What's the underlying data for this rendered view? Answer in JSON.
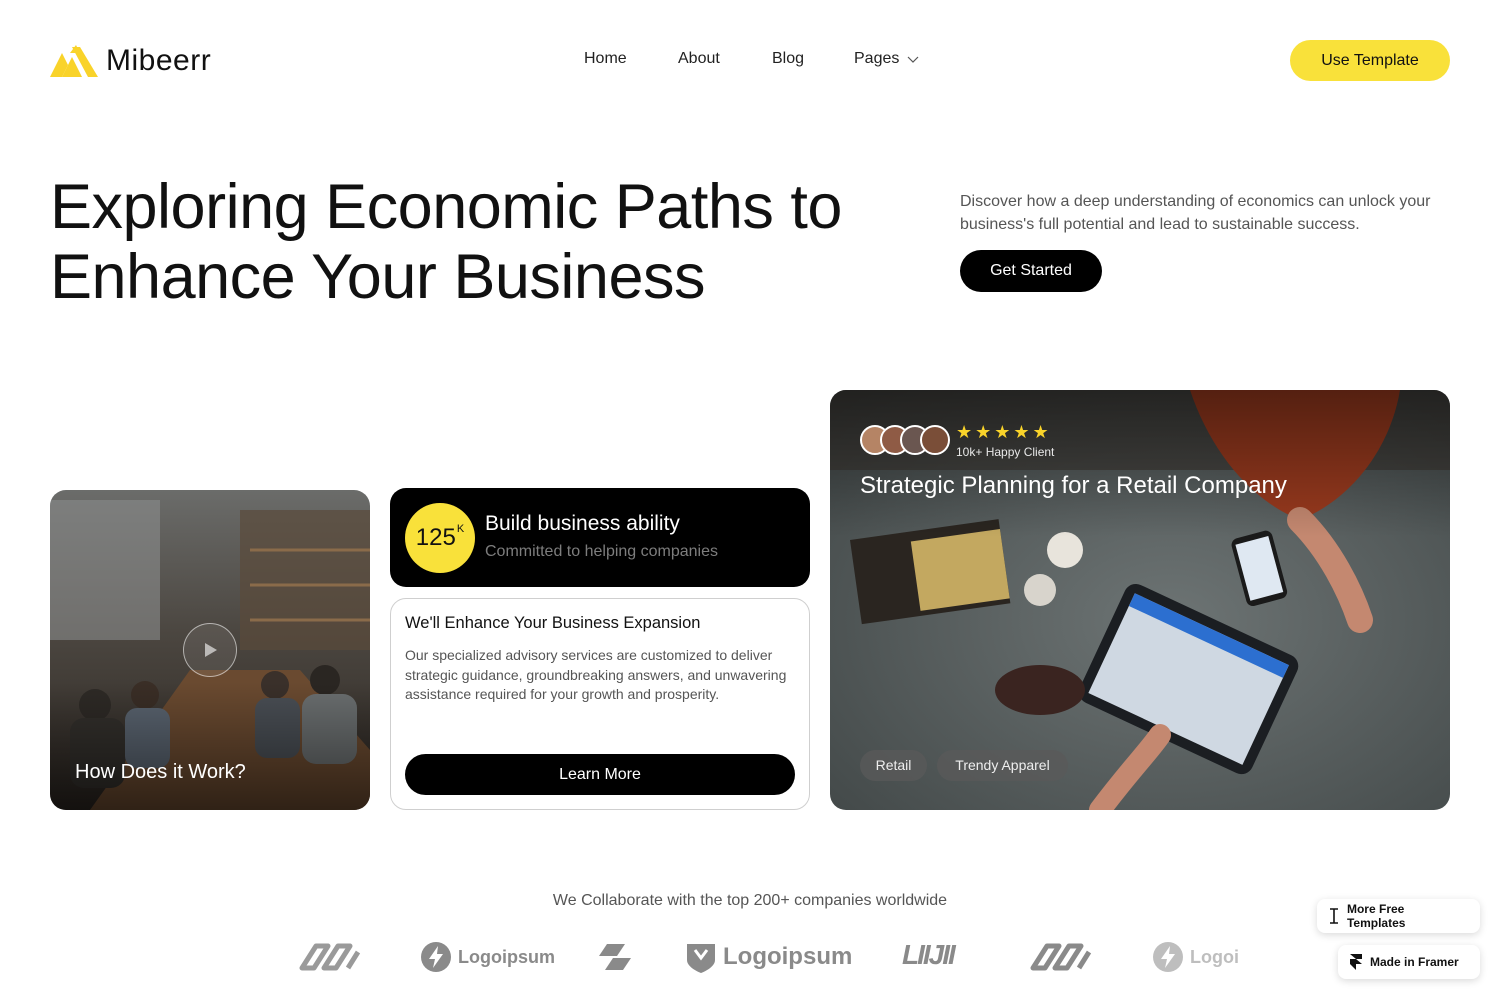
{
  "header": {
    "logo_text": "Mibeerr",
    "nav": [
      {
        "label": "Home"
      },
      {
        "label": "About"
      },
      {
        "label": "Blog"
      },
      {
        "label": "Pages"
      }
    ],
    "cta_label": "Use Template"
  },
  "hero": {
    "title": "Exploring Economic Paths to Enhance Your Business",
    "description": "Discover how a deep understanding of economics can unlock your business's full potential and lead to sustainable success.",
    "cta_label": "Get Started"
  },
  "video_card": {
    "label": "How Does it Work?"
  },
  "stat_card": {
    "number": "125",
    "suffix": "K",
    "title": "Build business ability",
    "subtitle": "Committed to helping companies"
  },
  "info_card": {
    "title": "We'll Enhance Your Business Expansion",
    "body": "Our specialized advisory services are customized to deliver strategic guidance, groundbreaking answers, and unwavering assistance required for your growth and prosperity.",
    "cta_label": "Learn More"
  },
  "case_card": {
    "stars": "★★★★★",
    "rating_count": 5,
    "clients_label": "10k+ Happy Client",
    "title": "Strategic Planning for a Retail Company",
    "tags": [
      "Retail",
      "Trendy Apparel"
    ]
  },
  "partners": {
    "heading": "We Collaborate with the top 200+ companies worldwide",
    "logos": [
      {
        "icon": "infinity-logo-icon"
      },
      {
        "icon": "bolt-logo-icon",
        "text": "Logoipsum"
      },
      {
        "icon": "slash-logo-icon"
      },
      {
        "icon": "shield-logo-icon",
        "text": "Logoipsum"
      },
      {
        "icon": "logo-wordmark-icon"
      },
      {
        "icon": "infinity-logo-icon"
      },
      {
        "icon": "bolt-logo-icon",
        "text": "Logoi"
      }
    ]
  },
  "floating": {
    "templates_label": "More Free Templates",
    "framer_label": "Made in Framer"
  },
  "colors": {
    "accent": "#f9e13a",
    "dark": "#000000"
  }
}
